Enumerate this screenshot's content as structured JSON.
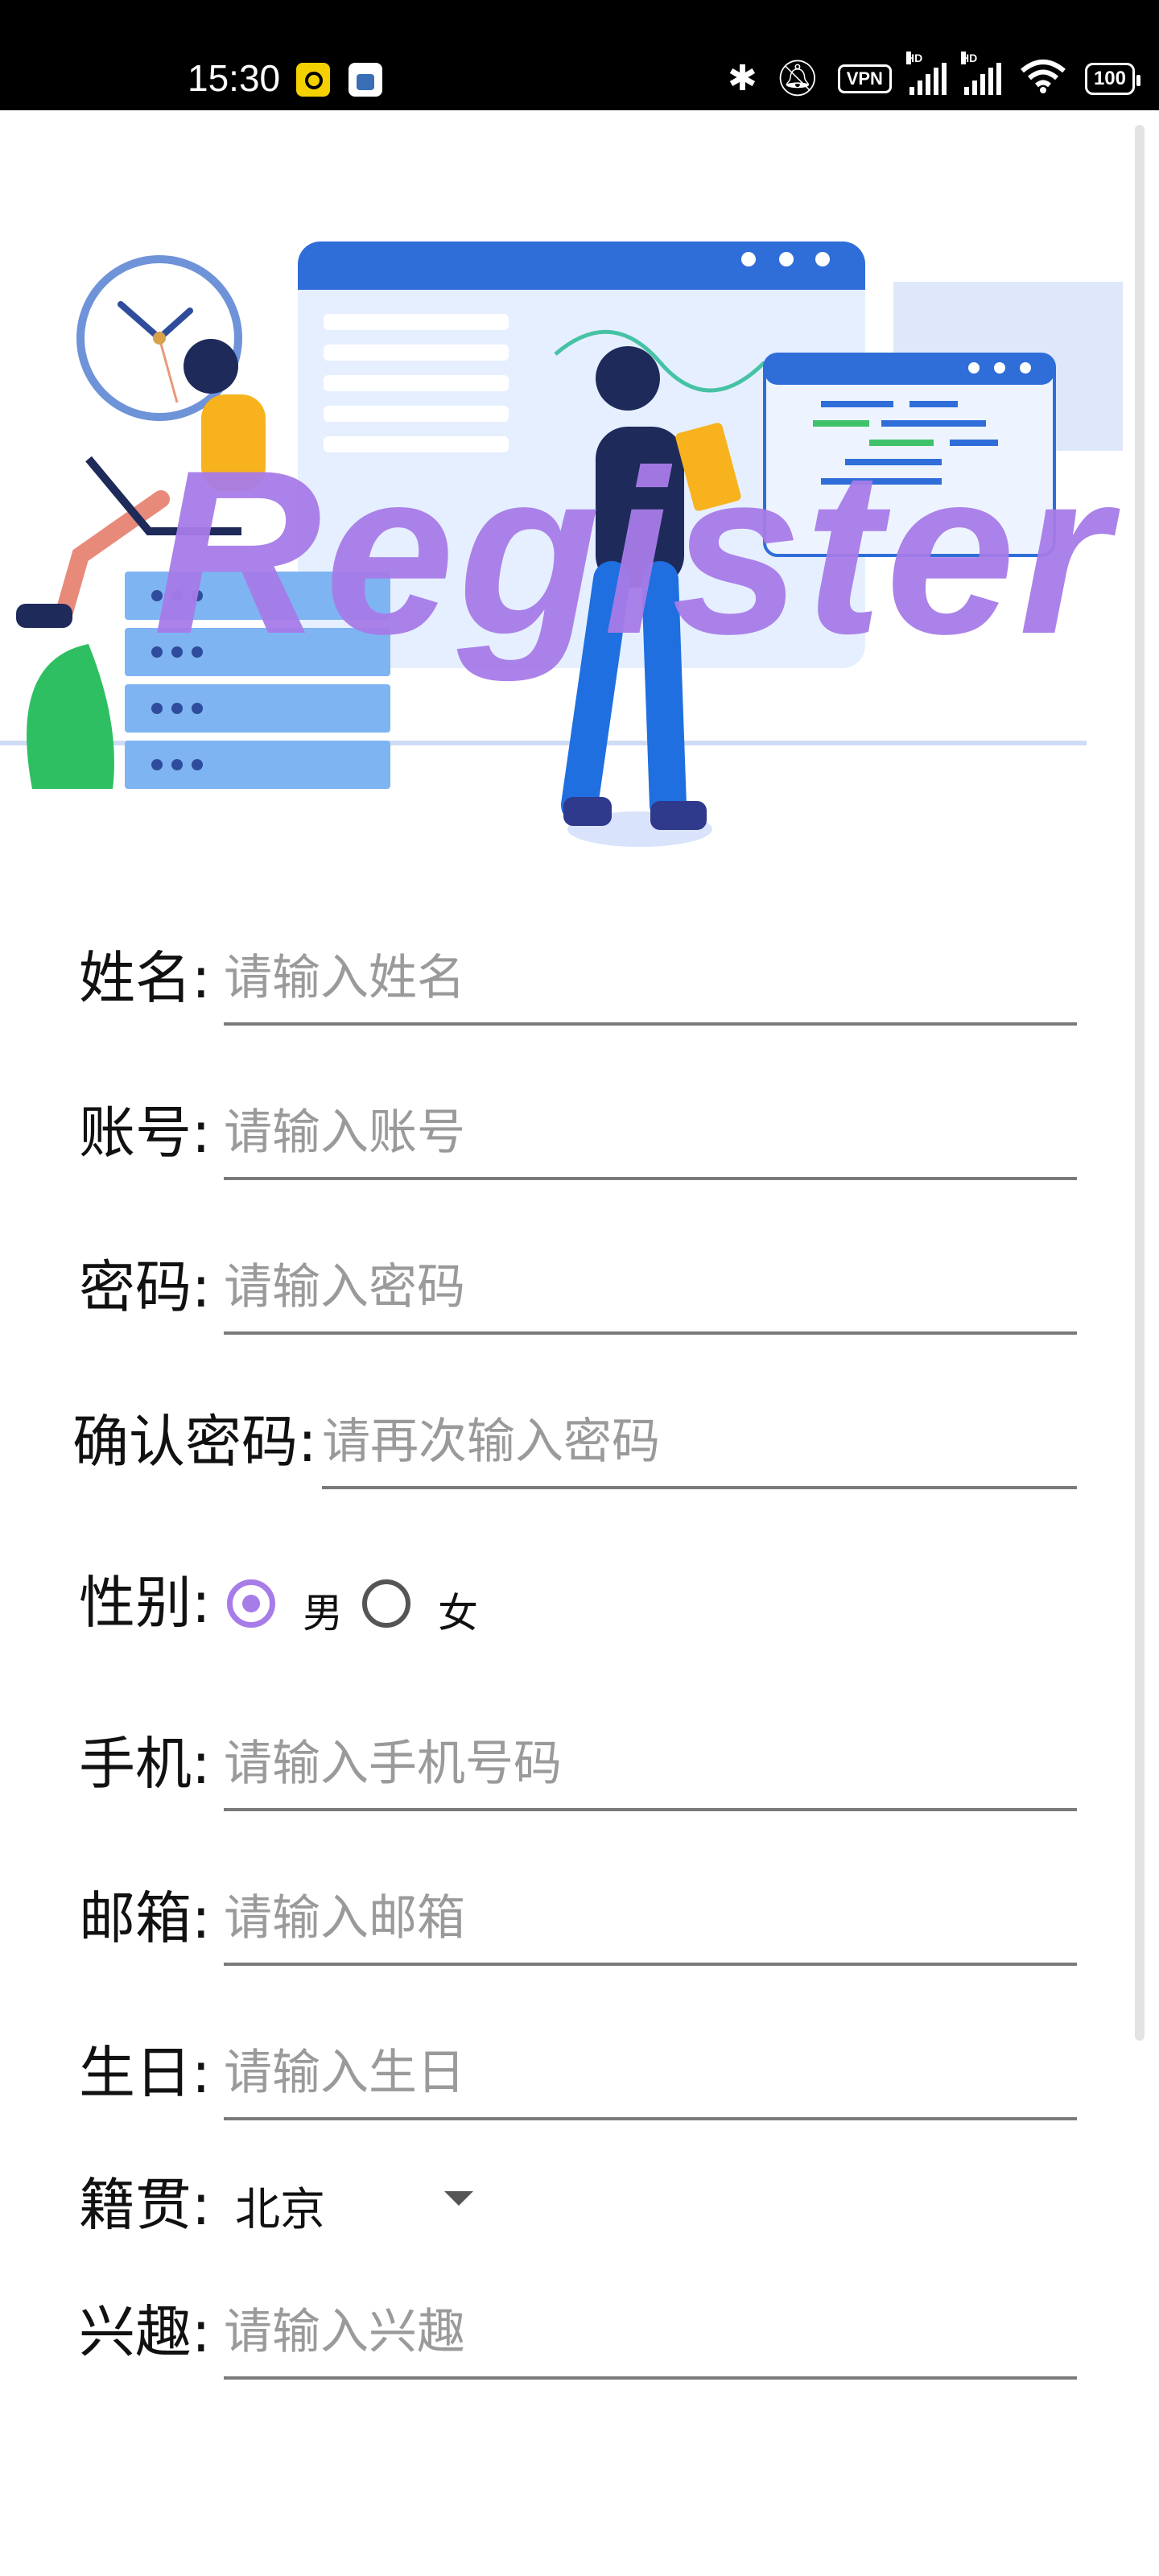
{
  "status_bar": {
    "time": "15:30",
    "vpn": "VPN",
    "hd1": "HD",
    "hd2": "HD",
    "battery": "100"
  },
  "hero": {
    "title": "Register"
  },
  "form": {
    "name": {
      "label": "姓名:",
      "placeholder": "请输入姓名"
    },
    "account": {
      "label": "账号:",
      "placeholder": "请输入账号"
    },
    "password": {
      "label": "密码:",
      "placeholder": "请输入密码"
    },
    "confirm": {
      "label": "确认密码:",
      "placeholder": "请再次输入密码"
    },
    "gender": {
      "label": "性别:",
      "options": [
        "男",
        "女"
      ],
      "selected": "男"
    },
    "phone": {
      "label": "手机:",
      "placeholder": "请输入手机号码"
    },
    "email": {
      "label": "邮箱:",
      "placeholder": "请输入邮箱"
    },
    "birthday": {
      "label": "生日:",
      "placeholder": "请输入生日"
    },
    "hometown": {
      "label": "籍贯:",
      "value": "北京"
    },
    "hobby": {
      "label": "兴趣:",
      "placeholder": "请输入兴趣"
    }
  },
  "colors": {
    "accent": "#a77ce8",
    "underline": "#7a7a7a",
    "placeholder": "#9a9a9a"
  }
}
